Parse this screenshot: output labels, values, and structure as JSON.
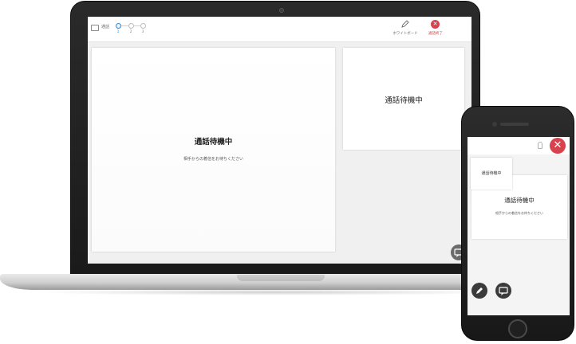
{
  "laptop": {
    "toolbar": {
      "app_label": "通話",
      "steps": [
        "1",
        "2",
        "3"
      ],
      "whiteboard_label": "ホワイトボード",
      "end_call_label": "通話終了"
    },
    "main_video": {
      "title": "通話待機中",
      "subtitle": "相手からの着信をお待ちください"
    },
    "side_video": {
      "title": "通話待機中"
    }
  },
  "phone": {
    "main_video": {
      "title": "通話待機中",
      "subtitle": "相手からの着信をお待ちください"
    },
    "self_video": {
      "title": "通話待機中"
    }
  },
  "colors": {
    "end_call_red": "#d9414c",
    "step_active_blue": "#2a8be0",
    "device_frame": "#1f1f1f"
  },
  "icons": [
    "app-window-icon",
    "pen-icon",
    "close-icon",
    "chat-icon",
    "person-icon"
  ]
}
